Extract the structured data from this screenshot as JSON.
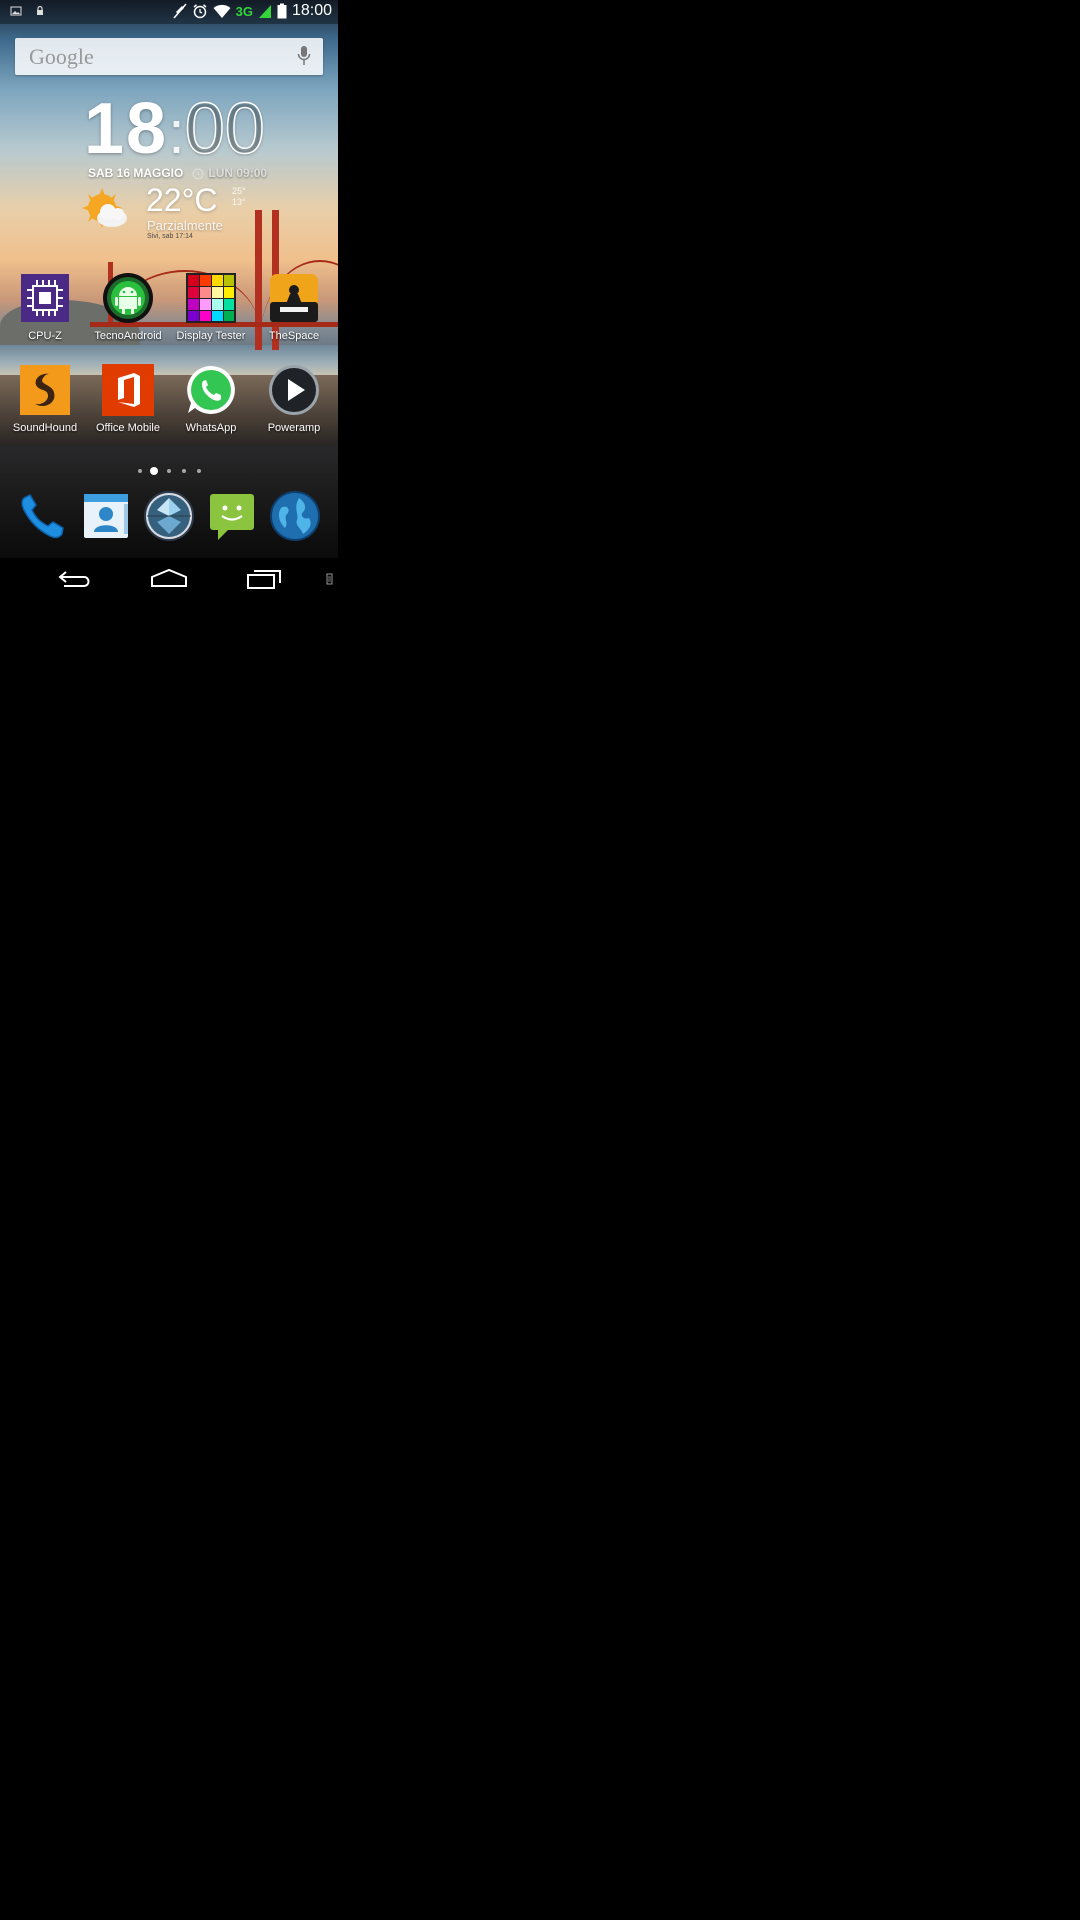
{
  "status_bar": {
    "left_icons": [
      "image-notification-icon",
      "lock-icon"
    ],
    "right_icons": [
      "mute-icon",
      "alarm-icon",
      "wifi-icon",
      "signal-icon",
      "battery-icon"
    ],
    "network": "3G",
    "time": "18:00"
  },
  "search": {
    "logo": "Google",
    "mic_icon": "mic-icon"
  },
  "clock_widget": {
    "hours": "18",
    "separator": ":",
    "minutes": "00",
    "date": "SAB 16 MAGGIO",
    "alarm": "LUN 09:00"
  },
  "weather_widget": {
    "temperature": "22°C",
    "range_high": "25°",
    "range_low": "13°",
    "description": "Parzialmente",
    "location": "Sivi, sab 17:14"
  },
  "apps": [
    {
      "label": "CPU-Z",
      "icon": "cpu-z-icon"
    },
    {
      "label": "TecnoAndroid",
      "icon": "tecnoandroid-icon"
    },
    {
      "label": "Display Tester",
      "icon": "display-tester-icon"
    },
    {
      "label": "TheSpace",
      "icon": "thespace-icon"
    },
    {
      "label": "SoundHound",
      "icon": "soundhound-icon"
    },
    {
      "label": "Office Mobile",
      "icon": "office-icon"
    },
    {
      "label": "WhatsApp",
      "icon": "whatsapp-icon"
    },
    {
      "label": "Poweramp",
      "icon": "poweramp-icon"
    }
  ],
  "dock": [
    "phone-icon",
    "contacts-icon",
    "app-drawer-icon",
    "messaging-icon",
    "browser-icon"
  ],
  "page_indicator": {
    "count": 5,
    "active": 1
  },
  "nav": [
    "back-icon",
    "home-icon",
    "recents-icon"
  ],
  "colors": {
    "network_green": "#35d43b",
    "cpu_z_purple": "#4b2a86",
    "office_orange": "#e03b00",
    "whatsapp_green": "#34c653",
    "soundhound_orange": "#f39a1a"
  }
}
